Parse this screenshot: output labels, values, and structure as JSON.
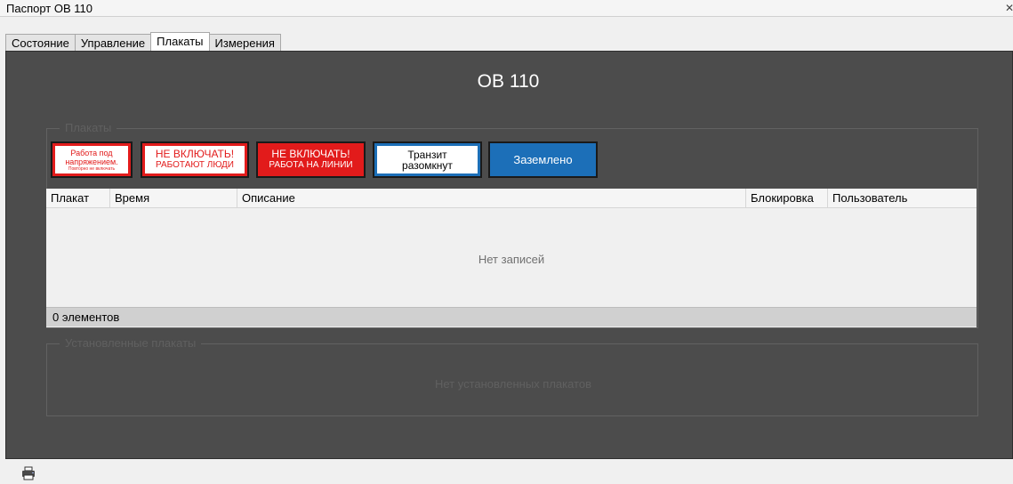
{
  "window": {
    "title": "Паспорт ОВ 110",
    "close_glyph": "✕"
  },
  "tabs": [
    {
      "label": "Состояние",
      "active": false
    },
    {
      "label": "Управление",
      "active": false
    },
    {
      "label": "Плакаты",
      "active": true
    },
    {
      "label": "Измерения",
      "active": false
    }
  ],
  "main": {
    "heading": "ОВ 110",
    "posters_group": {
      "legend": "Плакаты",
      "posters": [
        {
          "lines": [
            "Работа под",
            "напряжением.",
            "Повторно не включать"
          ]
        },
        {
          "lines": [
            "НЕ ВКЛЮЧАТЬ!",
            "РАБОТАЮТ ЛЮДИ"
          ]
        },
        {
          "lines": [
            "НЕ ВКЛЮЧАТЬ!",
            "РАБОТА НА ЛИНИИ"
          ]
        },
        {
          "lines": [
            "Транзит",
            "разомкнут"
          ]
        },
        {
          "lines": [
            "Заземлено"
          ]
        }
      ]
    },
    "table": {
      "columns": [
        "Плакат",
        "Время",
        "Описание",
        "Блокировка",
        "Пользователь"
      ],
      "empty_text": "Нет записей",
      "footer": "0 элементов"
    },
    "installed_group": {
      "legend": "Установленные плакаты",
      "empty_text": "Нет установленных плакатов"
    }
  },
  "colors": {
    "poster_red": "#e21b1b",
    "poster_blue": "#1c6fb8",
    "panel_bg": "#4c4c4c"
  },
  "icons": {
    "print": "printer-icon"
  }
}
